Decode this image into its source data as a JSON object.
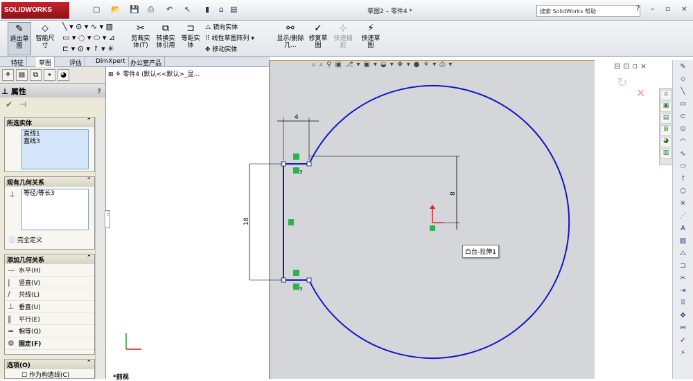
{
  "app": {
    "logo": "SOLIDWORKS",
    "window_title": "草图2 – 零件4 *",
    "search_placeholder": "搜索 SolidWorks 帮助",
    "window_buttons": "? – ▫ ×"
  },
  "ribbon": {
    "exit_sketch": "退出草图",
    "smart_dim": "智能尺寸",
    "trim": "剪裁实体(T)",
    "convert": "转换实体引用",
    "offset": "等距实体",
    "mirror": "镜向实体",
    "linear_pattern": "线性草图阵列",
    "move": "移动实体",
    "display_delete": "显示/删除几...",
    "repair": "修复草图",
    "quick_snap": "快速捕捉",
    "rapid_sketch": "快速草图"
  },
  "tabs": [
    "特征",
    "草图",
    "评估",
    "DimXpert",
    "办公室产品"
  ],
  "panel": {
    "title": "属性",
    "help": "?",
    "selected_group": "所选实体",
    "selected_items": [
      "直线1",
      "直线3"
    ],
    "existing_group": "现有几何关系",
    "existing_items": [
      "等径/等长3"
    ],
    "status": "完全定义",
    "add_group": "添加几何关系",
    "relations": [
      {
        "icon": "—",
        "label": "水平(H)"
      },
      {
        "icon": "|",
        "label": "竖直(V)"
      },
      {
        "icon": "/",
        "label": "共线(L)"
      },
      {
        "icon": "⊥",
        "label": "垂直(U)"
      },
      {
        "icon": "∥",
        "label": "平行(E)"
      },
      {
        "icon": "=",
        "label": "相等(Q)"
      },
      {
        "icon": "⚙",
        "label": "固定(F)"
      }
    ],
    "options_group": "选项(O)",
    "construction": "作为构造线(C)"
  },
  "tree": {
    "part": "零件4 (默认<<默认>_显..."
  },
  "viewport": {
    "tooltip": "凸台-拉伸1",
    "view_label": "*前视"
  },
  "dims": {
    "top": "4",
    "left": "18",
    "right": "8"
  },
  "relation_marks": {
    "equal_count": "3"
  },
  "colors": {
    "sketch_blue": "#1414c8",
    "dim_line": "#000000",
    "relation_green": "#2ab44a",
    "viewport_bg": "#d4d6da"
  }
}
